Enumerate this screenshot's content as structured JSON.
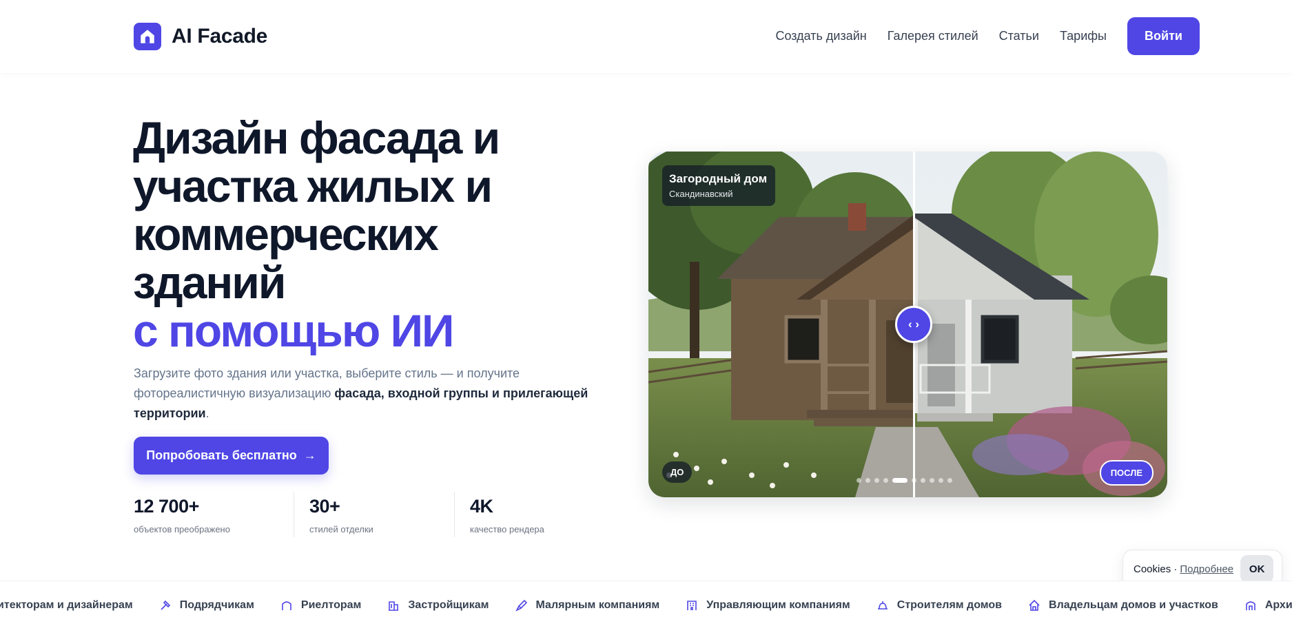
{
  "header": {
    "brand": "AI Facade",
    "nav": [
      "Создать дизайн",
      "Галерея стилей",
      "Статьи",
      "Тарифы"
    ],
    "login": "Войти"
  },
  "hero": {
    "title_lines": [
      "Дизайн фасада и",
      "участка жилых и",
      "коммерческих",
      "зданий"
    ],
    "title_accent": "с помощью ИИ",
    "subtitle_start": "Загрузите фото здания или участка, выберите стиль — и получите фотореалистичную визуализацию ",
    "subtitle_bold": "фасада, входной группы и прилегающей территории",
    "subtitle_end": ".",
    "cta": "Попробовать бесплатно",
    "cta_arrow": "→"
  },
  "stats": [
    {
      "value": "12 700+",
      "label": "объектов преображено"
    },
    {
      "value": "30+",
      "label": "стилей отделки"
    },
    {
      "value": "4K",
      "label": "качество рендера"
    }
  ],
  "compare": {
    "title": "Загородный дом",
    "style": "Скандинавский",
    "before": "ДО",
    "after": "ПОСЛЕ",
    "handle": "‹ ›",
    "slides_total": 10,
    "slide_active": 4
  },
  "cookies": {
    "text": "Cookies ·",
    "link": "Подробнее",
    "ok": "OK"
  },
  "audiences": [
    {
      "icon": "compass-icon",
      "label": "Архитекторам и дизайнерам"
    },
    {
      "icon": "hammer-icon",
      "label": "Подрядчикам"
    },
    {
      "icon": "house-outline-icon",
      "label": "Риелторам"
    },
    {
      "icon": "building-icon",
      "label": "Застройщикам"
    },
    {
      "icon": "brush-icon",
      "label": "Малярным компаниям"
    },
    {
      "icon": "office-icon",
      "label": "Управляющим компаниям"
    },
    {
      "icon": "hardhat-icon",
      "label": "Строителям домов"
    },
    {
      "icon": "home-icon",
      "label": "Владельцам домов и участков"
    },
    {
      "icon": "arch-icon",
      "label": "Архитекторам и дизайнерам"
    }
  ],
  "colors": {
    "accent": "#4f46e5",
    "text": "#0f172a",
    "muted": "#64748b"
  }
}
